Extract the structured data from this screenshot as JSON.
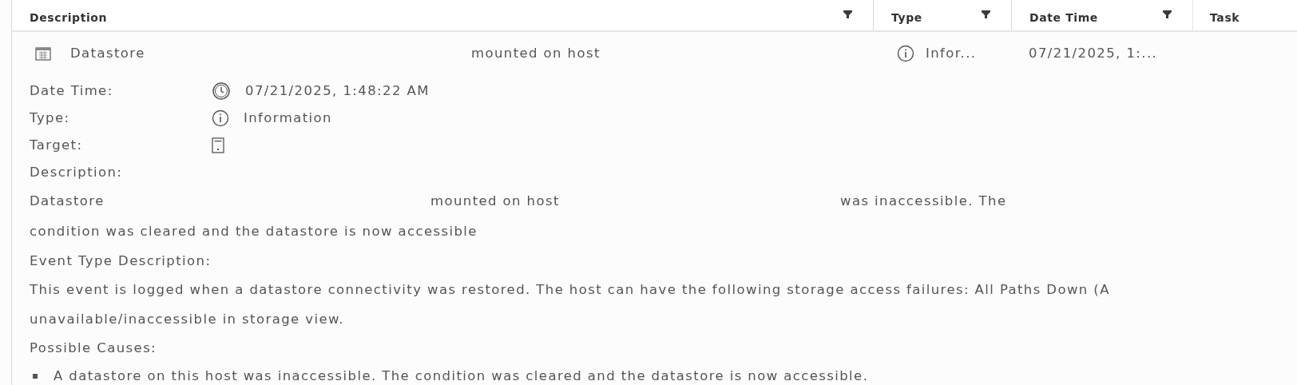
{
  "table": {
    "columns": [
      {
        "label": "Description",
        "filter": true
      },
      {
        "label": "Type",
        "filter": true
      },
      {
        "label": "Date Time",
        "filter": true
      },
      {
        "label": "Task",
        "filter": false
      }
    ],
    "rows": [
      {
        "description": [
          "Datastore",
          "mounted on host"
        ],
        "type": "Infor...",
        "date_time": "07/21/2025, 1:..."
      }
    ]
  },
  "details": {
    "fields": [
      {
        "label": "Date Time:",
        "kind": "time",
        "value": "07/21/2025, 1:48:22 AM"
      },
      {
        "label": "Type:",
        "kind": "info",
        "value": "Information"
      },
      {
        "label": "Target:",
        "kind": "target"
      }
    ],
    "description_label": "Description:",
    "description": [
      [
        "Datastore",
        "mounted on host",
        "was inaccessible. The"
      ],
      [
        "condition was cleared and the datastore is now accessible"
      ]
    ],
    "event_type_label": "Event Type Description:",
    "event_type_text": [
      "This event is logged when a datastore connectivity was restored. The host can have the following storage access failures: All Paths Down (A",
      "unavailable/inaccessible in storage view."
    ],
    "causes_label": "Possible Causes:",
    "causes": [
      "A datastore on this host was inaccessible. The condition was cleared and the datastore is now accessible."
    ]
  }
}
